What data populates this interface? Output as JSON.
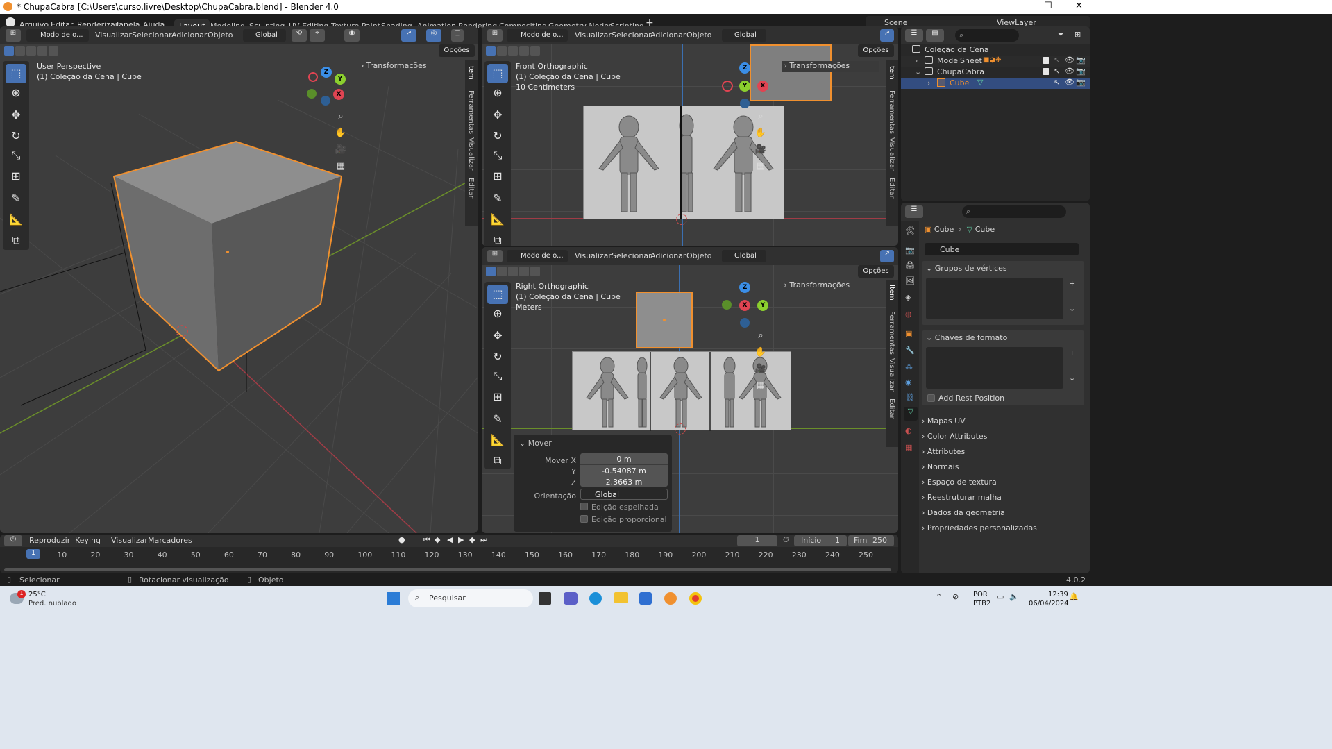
{
  "window": {
    "title": "* ChupaCabra [C:\\Users\\curso.livre\\Desktop\\ChupaCabra.blend] - Blender 4.0",
    "minimize": "—",
    "maximize": "☐",
    "close": "✕"
  },
  "menu": [
    "Arquivo",
    "Editar",
    "Renderizar",
    "Janela",
    "Ajuda"
  ],
  "workspaces": [
    "Layout",
    "Modeling",
    "Sculpting",
    "UV Editing",
    "Texture Paint",
    "Shading",
    "Animation",
    "Rendering",
    "Compositing",
    "Geometry Nodes",
    "Scripting"
  ],
  "workspace_add": "+",
  "scene": {
    "label": "Scene",
    "view_layer": "ViewLayer"
  },
  "viewport_header": {
    "mode": "Modo de o...",
    "visualizar": "Visualizar",
    "selecionar": "Selecionar",
    "adicionar": "Adicionar",
    "objeto": "Objeto",
    "orientation": "Global",
    "options": "Opções"
  },
  "viewport_main": {
    "line1": "User Perspective",
    "line2": "(1) Coleção da Cena | Cube",
    "sidebar_title": "Transformações",
    "tabs": [
      "Item",
      "Ferramentas",
      "Visualizar",
      "Editar"
    ]
  },
  "viewport_front": {
    "line1": "Front Orthographic",
    "line2": "(1) Coleção da Cena | Cube",
    "line3": "10 Centimeters",
    "sidebar_title": "Transformações"
  },
  "viewport_right": {
    "line1": "Right Orthographic",
    "line2": "(1) Coleção da Cena | Cube",
    "line3": "Meters",
    "sidebar_title": "Transformações"
  },
  "gizmo_labels": {
    "x": "X",
    "y": "Y",
    "z": "Z"
  },
  "mover_panel": {
    "title": "Mover",
    "x_label": "Mover X",
    "x": "0 m",
    "y_label": "Y",
    "y": "-0.54087 m",
    "z_label": "Z",
    "z": "2.3663 m",
    "orient_label": "Orientação",
    "orient": "Global",
    "mirror": "Edição espelhada",
    "proportional": "Edição proporcional"
  },
  "outliner": {
    "search_placeholder": "",
    "rows": [
      {
        "name": "Coleção da Cena"
      },
      {
        "name": "ModelSheet"
      },
      {
        "name": "ChupaCabra"
      },
      {
        "name": "Cube"
      }
    ]
  },
  "properties": {
    "breadcrumb_obj": "Cube",
    "breadcrumb_data": "Cube",
    "data_name": "Cube",
    "sections": [
      "Grupos de vértices",
      "Chaves de formato"
    ],
    "add_rest": "Add Rest Position",
    "collapsed": [
      "Mapas UV",
      "Color Attributes",
      "Attributes",
      "Normais",
      "Espaço de textura",
      "Reestruturar malha",
      "Dados da geometria",
      "Propriedades personalizadas"
    ]
  },
  "timeline": {
    "reproduzir": "Reproduzir",
    "keying": "Keying",
    "visualizar": "Visualizar",
    "marcadores": "Marcadores",
    "current_frame": "1",
    "inicio_label": "Início",
    "inicio": "1",
    "fim_label": "Fim",
    "fim": "250",
    "ticks": [
      "1",
      "10",
      "20",
      "30",
      "40",
      "50",
      "60",
      "70",
      "80",
      "90",
      "100",
      "110",
      "120",
      "130",
      "140",
      "150",
      "160",
      "170",
      "180",
      "190",
      "200",
      "210",
      "220",
      "230",
      "240",
      "250"
    ]
  },
  "statusbar": {
    "select": "Selecionar",
    "rotate": "Rotacionar visualização",
    "object": "Objeto",
    "version": "4.0.2"
  },
  "taskbar": {
    "weather_temp": "25°C",
    "weather_desc": "Pred. nublado",
    "weather_badge": "1",
    "search": "Pesquisar",
    "lang1": "POR",
    "lang2": "PTB2",
    "time": "12:39",
    "date": "06/04/2024"
  },
  "colors": {
    "accent": "#4772b3",
    "selection": "#f0902f",
    "axis_x": "#e04452",
    "axis_y": "#8bcf2e",
    "axis_z": "#3b8ee6"
  }
}
